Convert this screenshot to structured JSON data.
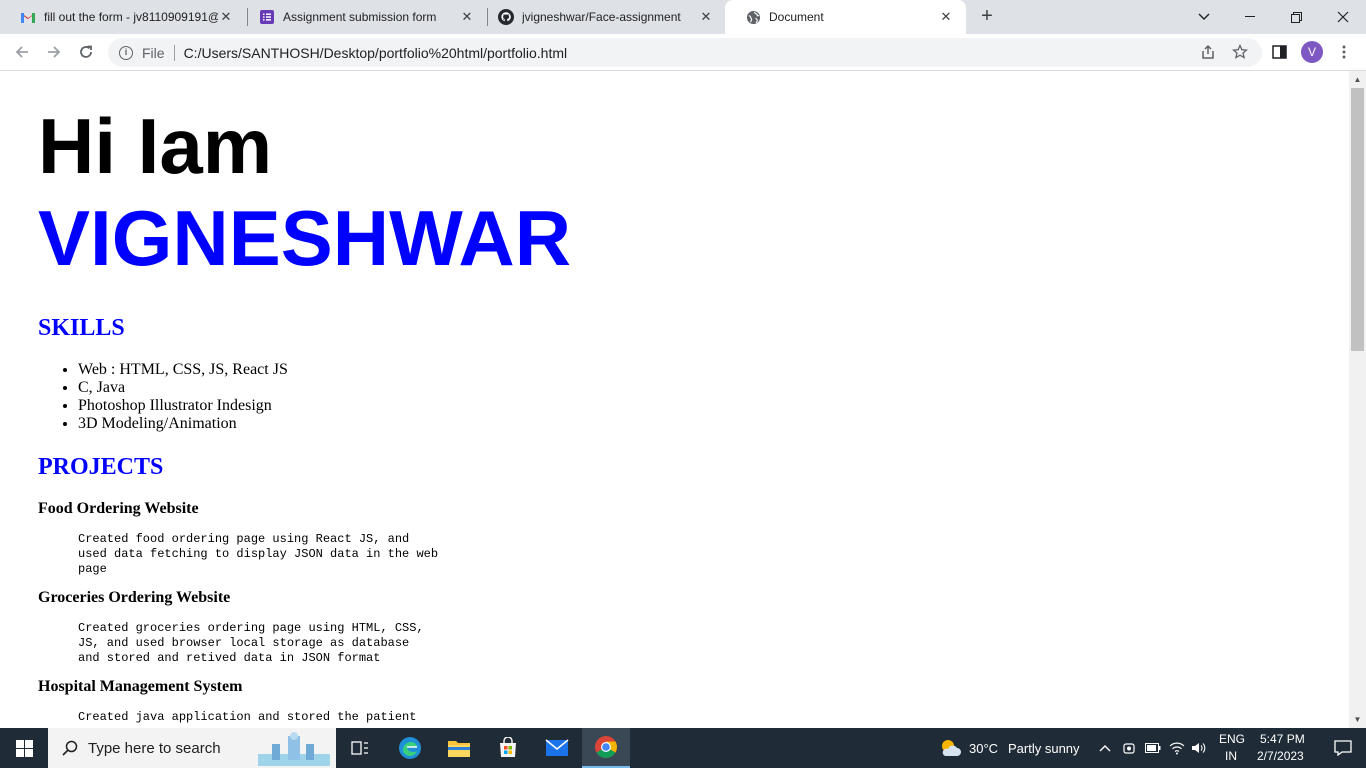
{
  "browser": {
    "tabs": [
      {
        "title": "fill out the form - jv8110909191@",
        "icon": "gmail-icon",
        "active": false
      },
      {
        "title": "Assignment submission form",
        "icon": "forms-icon",
        "active": false
      },
      {
        "title": "jvigneshwar/Face-assignment",
        "icon": "github-icon",
        "active": false
      },
      {
        "title": "Document",
        "icon": "globe-icon",
        "active": true
      }
    ],
    "omnibox": {
      "scheme_label": "File",
      "url": "C:/Users/SANTHOSH/Desktop/portfolio%20html/portfolio.html"
    },
    "profile_initial": "V"
  },
  "page": {
    "greeting": "Hi Iam",
    "name": "VIGNESHWAR",
    "skills_heading": "SKILLS",
    "skills": [
      "Web : HTML, CSS, JS, React JS",
      "C, Java",
      "Photoshop Illustrator Indesign",
      "3D Modeling/Animation"
    ],
    "projects_heading": "PROJECTS",
    "projects": [
      {
        "title": "Food Ordering Website",
        "desc_lines": [
          "Created food ordering page using React JS, and",
          "used data fetching to display JSON data in the web",
          "page"
        ]
      },
      {
        "title": "Groceries Ordering Website",
        "desc_lines": [
          "Created groceries ordering page using HTML, CSS,",
          "JS, and used browser local storage as database",
          "and stored and retived data in JSON format"
        ]
      },
      {
        "title": "Hospital Management System",
        "desc_lines": [
          "Created java application and stored the patient"
        ]
      }
    ]
  },
  "taskbar": {
    "search_placeholder": "Type here to search",
    "weather": {
      "temp": "30°C",
      "condition": "Partly sunny"
    },
    "language": {
      "lang": "ENG",
      "region": "IN"
    },
    "clock": {
      "time": "5:47 PM",
      "date": "2/7/2023"
    }
  },
  "colors": {
    "accent_blue": "#0000ff",
    "tabstrip_bg": "#dee1e6",
    "taskbar_bg": "#1f2b36"
  }
}
